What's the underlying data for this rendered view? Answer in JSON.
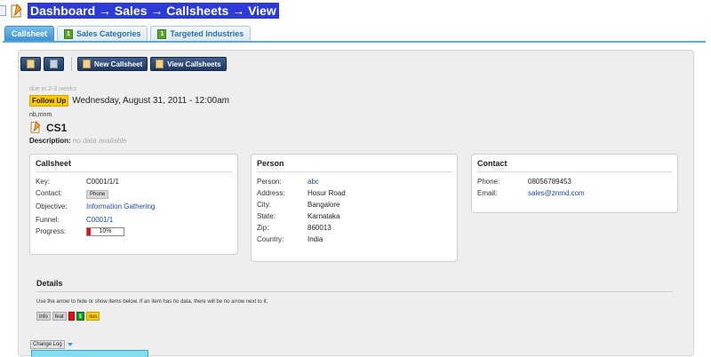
{
  "breadcrumb": "Dashboard → Sales → Callsheets → View",
  "tabs": [
    {
      "label": "Callsheet",
      "count": null,
      "active": true
    },
    {
      "label": "Sales Categories",
      "count": "1",
      "active": false
    },
    {
      "label": "Targeted Industries",
      "count": "1",
      "active": false
    }
  ],
  "toolbar": {
    "edit_icon": "edit-icon",
    "delete_icon": "trash-icon",
    "new_label": "New Callsheet",
    "view_label": "View Callsheets"
  },
  "header": {
    "due": "due in 2-3 weeks",
    "followup_badge": "Follow Up",
    "followup_date": "Wednesday, August 31, 2011 - 12:00am",
    "owner": "nb,mnm",
    "name": "CS1",
    "description_label": "Description:",
    "description_value": "no data available"
  },
  "callsheet": {
    "title": "Callsheet",
    "key_label": "Key:",
    "key": "C0001/1/1",
    "contact_label": "Contact:",
    "contact": "Phone",
    "objective_label": "Objective:",
    "objective": "Information Gathering",
    "funnel_label": "Funnel:",
    "funnel": "C0001/1",
    "progress_label": "Progress:",
    "progress_text": "10%",
    "progress_value": 0.1
  },
  "person": {
    "title": "Person",
    "person_label": "Person:",
    "person": "abc",
    "address_label": "Address:",
    "address": "Hosur Road",
    "city_label": "City:",
    "city": "Bangalore",
    "state_label": "State:",
    "state": "Karnataka",
    "zip_label": "Zip:",
    "zip": "860013",
    "country_label": "Country:",
    "country": "India"
  },
  "contact": {
    "title": "Contact",
    "phone_label": "Phone:",
    "phone": "08056789453",
    "email_label": "Email:",
    "email": "sales@znmd.com"
  },
  "details": {
    "title": "Details",
    "help": "Use the arrow to hide or show items below. If an item has no data, there will be no arrow next to it.",
    "tags": [
      "info",
      "feat",
      "",
      "$",
      "sus"
    ]
  },
  "changelog_label": "Change Log",
  "colors": {
    "accent": "#5aa8dc",
    "title_highlight": "#2c3bd6",
    "toolbar_button": "#2b4a76",
    "followup": "#ffc900",
    "progress": "#e2101a"
  }
}
